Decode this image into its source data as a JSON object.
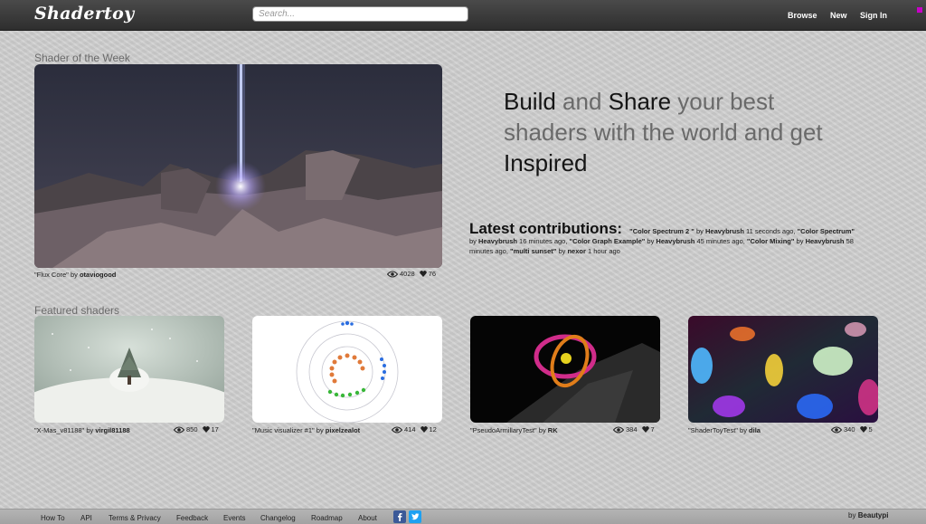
{
  "header": {
    "logo": "Shadertoy",
    "search_placeholder": "Search...",
    "nav": [
      "Browse",
      "New",
      "Sign In"
    ]
  },
  "week": {
    "section_title": "Shader of the Week",
    "title": "\"Flux Core\"",
    "by": "by",
    "author": "otaviogood",
    "views": "4028",
    "likes": "76"
  },
  "hero": {
    "parts": [
      {
        "text": "Build",
        "dark": true
      },
      {
        "text": " and ",
        "dark": false
      },
      {
        "text": "Share",
        "dark": true
      },
      {
        "text": " your best shaders with the world and get ",
        "dark": false
      },
      {
        "text": "Inspired",
        "dark": true
      }
    ]
  },
  "latest": {
    "heading": "Latest contributions:",
    "items": [
      {
        "title": "\"Color Spectrum 2 \"",
        "by": "by",
        "author": "Heavybrush",
        "time": "11 seconds ago,"
      },
      {
        "title": "\"Color Spectrum\"",
        "by": "by",
        "author": "Heavybrush",
        "time": "16 minutes ago,"
      },
      {
        "title": "\"Color Graph Example\"",
        "by": "by",
        "author": "Heavybrush",
        "time": "45 minutes ago,"
      },
      {
        "title": "\"Color Mixing\"",
        "by": "by",
        "author": "Heavybrush",
        "time": "58 minutes ago,"
      },
      {
        "title": "\"multi sunset\"",
        "by": "by",
        "author": "nexor",
        "time": "1 hour ago"
      }
    ]
  },
  "featured": {
    "section_title": "Featured shaders",
    "items": [
      {
        "title": "\"X-Mas_v81188\"",
        "by": "by",
        "author": "virgil81188",
        "views": "850",
        "likes": "17"
      },
      {
        "title": "\"Music visualizer #1\"",
        "by": "by",
        "author": "pixelzealot",
        "views": "414",
        "likes": "12"
      },
      {
        "title": "\"PseudoArmillaryTest\"",
        "by": "by",
        "author": "RK",
        "views": "384",
        "likes": "7"
      },
      {
        "title": "\"ShaderToyTest\"",
        "by": "by",
        "author": "dila",
        "views": "340",
        "likes": "5"
      }
    ]
  },
  "footer": {
    "links": [
      "How To",
      "API",
      "Terms & Privacy",
      "Feedback",
      "Events",
      "Changelog",
      "Roadmap",
      "About"
    ],
    "by": "by",
    "author": "Beautypi"
  },
  "colors": {
    "header_bg": "#3a3a3a",
    "page_bg": "#cdcdcd",
    "accent": "#c700c7",
    "facebook": "#3b5998",
    "twitter": "#1da1f2"
  }
}
